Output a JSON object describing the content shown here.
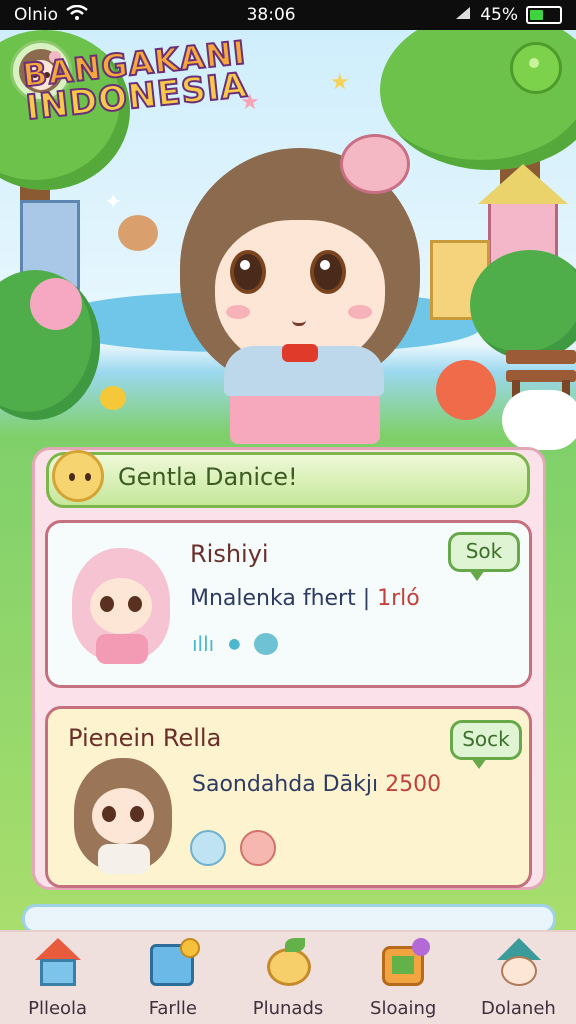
{
  "status_bar": {
    "carrier": "Olnio",
    "time": "38:06",
    "battery": "45%",
    "battery_level": 0.45
  },
  "header": {
    "logo_line1": "BANGAKANI",
    "logo_line2": "INDONESIA"
  },
  "panel": {
    "banner_text": "Gentla Danice!",
    "cards": [
      {
        "name": "Rishiyi",
        "desc_text": "Mnalenka fhert |",
        "desc_value": "1rló",
        "button": "Sok"
      },
      {
        "name": "Pienein Rella",
        "desc_text": "Saondahda Dākjı",
        "desc_value": "2500",
        "button": "Sock"
      }
    ]
  },
  "bottom_nav": {
    "items": [
      {
        "label": "Plleola",
        "icon": "home-icon"
      },
      {
        "label": "Farlle",
        "icon": "card-icon"
      },
      {
        "label": "Plunads",
        "icon": "friend-icon"
      },
      {
        "label": "Sloaing",
        "icon": "shop-icon"
      },
      {
        "label": "Dolaneh",
        "icon": "dress-icon"
      }
    ]
  }
}
